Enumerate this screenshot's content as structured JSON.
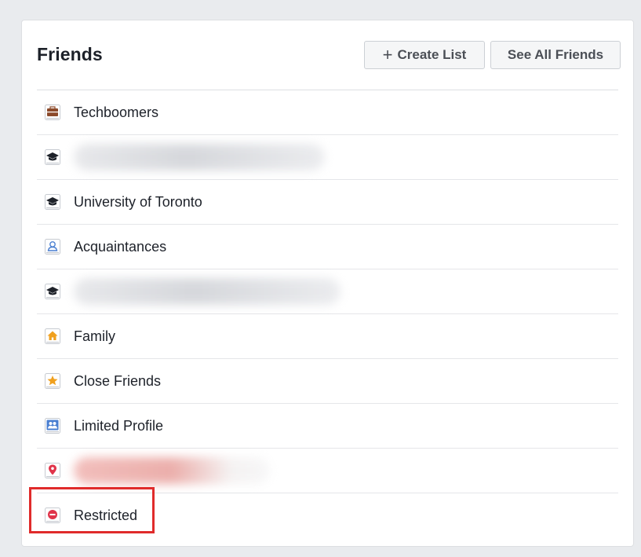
{
  "header": {
    "title": "Friends",
    "create_list_plus": "+",
    "create_list_label": "Create List",
    "see_all_label": "See All Friends"
  },
  "lists": [
    {
      "label": "Techboomers",
      "icon": "briefcase-icon",
      "redacted": false
    },
    {
      "label": "",
      "icon": "graduation-cap-icon",
      "redacted": true
    },
    {
      "label": "University of Toronto",
      "icon": "graduation-cap-icon",
      "redacted": false
    },
    {
      "label": "Acquaintances",
      "icon": "person-outline-icon",
      "redacted": false
    },
    {
      "label": "",
      "icon": "graduation-cap-icon",
      "redacted": true
    },
    {
      "label": "Family",
      "icon": "house-icon",
      "redacted": false
    },
    {
      "label": "Close Friends",
      "icon": "star-icon",
      "redacted": false
    },
    {
      "label": "Limited Profile",
      "icon": "people-icon",
      "redacted": false
    },
    {
      "label": "",
      "icon": "location-pin-icon",
      "redacted": true
    },
    {
      "label": "Restricted",
      "icon": "no-entry-icon",
      "redacted": false
    }
  ],
  "colors": {
    "highlight_border": "#e02b2b",
    "icon_dark": "#1d2129",
    "icon_brown": "#8b4a2b",
    "icon_blue": "#4a7fd1",
    "icon_orange": "#f0a01e",
    "icon_red": "#e0344a"
  }
}
